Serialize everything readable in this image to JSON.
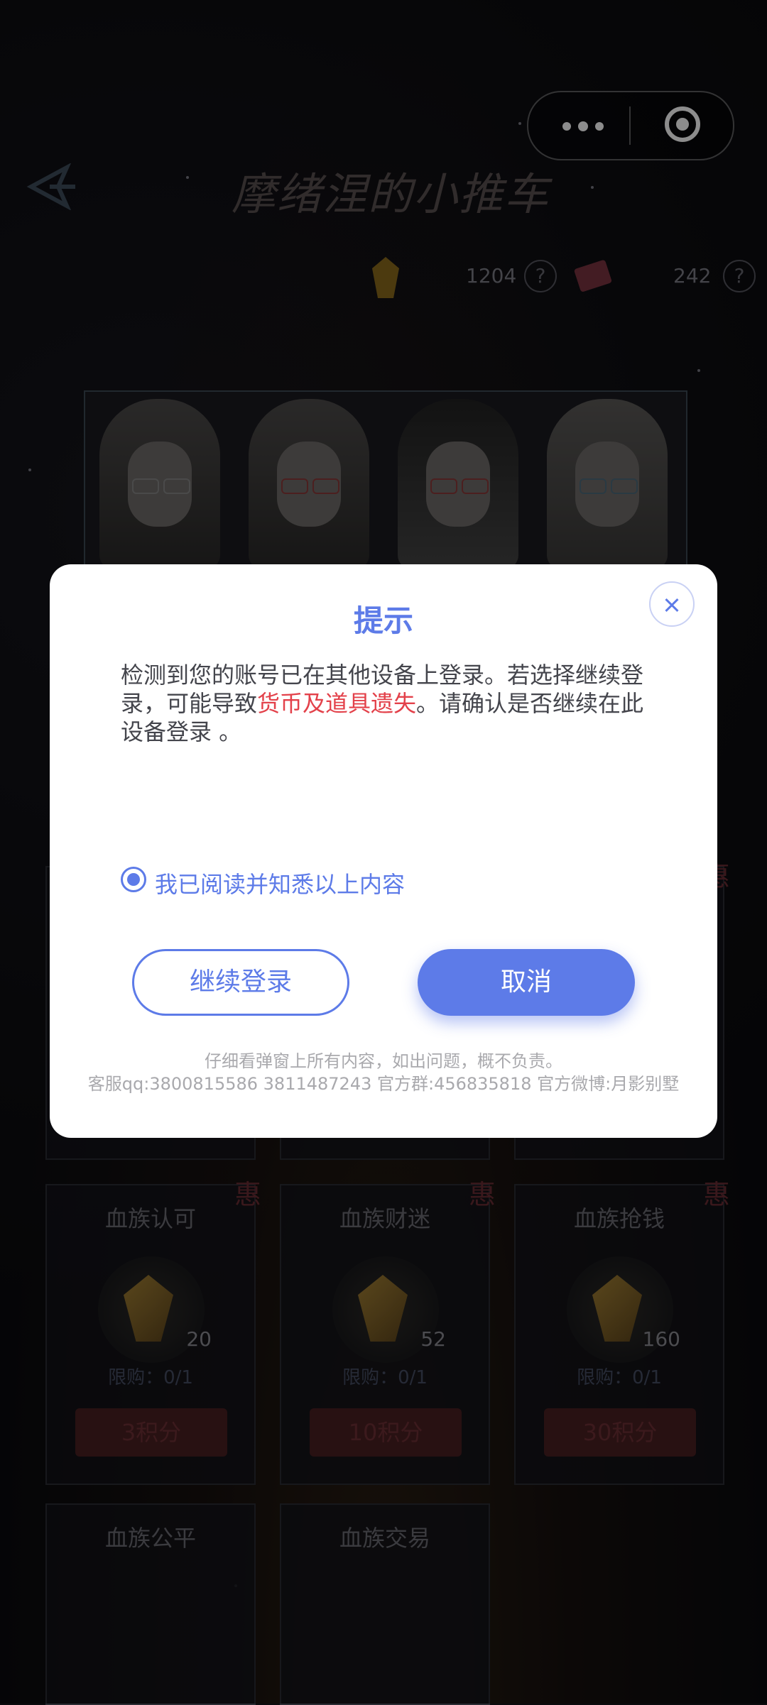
{
  "header": {
    "title": "摩绪涅的小推车"
  },
  "currencies": [
    {
      "name": "gem",
      "value": "1204"
    },
    {
      "name": "ticket",
      "value": "242"
    }
  ],
  "shop": {
    "hot_tag": "惠",
    "cards": [
      {
        "name": "血族认可",
        "count": "20",
        "limit": "限购：0/1",
        "price": "3积分"
      },
      {
        "name": "血族财迷",
        "count": "52",
        "limit": "限购：0/1",
        "price": "10积分"
      },
      {
        "name": "血族抢钱",
        "count": "160",
        "limit": "限购：0/1",
        "price": "30积分"
      },
      {
        "name": "血族公平"
      },
      {
        "name": "血族交易"
      }
    ]
  },
  "dialog": {
    "title": "提示",
    "body_part1": "检测到您的账号已在其他设备上登录。若选择继续登录，可能导致",
    "body_warning": "货币及道具遗失",
    "body_part2": "。请确认是否继续在此设备登录 。",
    "checkbox_label": "我已阅读并知悉以上内容",
    "checkbox_checked": true,
    "continue_label": "继续登录",
    "cancel_label": "取消",
    "footer_line1": "仔细看弹窗上所有内容，如出问题，概不负责。",
    "footer_line2": "客服qq:3800815586    3811487243 官方群:456835818 官方微博:月影别墅"
  },
  "colors": {
    "accent": "#5d7be8",
    "warning": "#e3414a",
    "background": "#0b0b0e"
  }
}
